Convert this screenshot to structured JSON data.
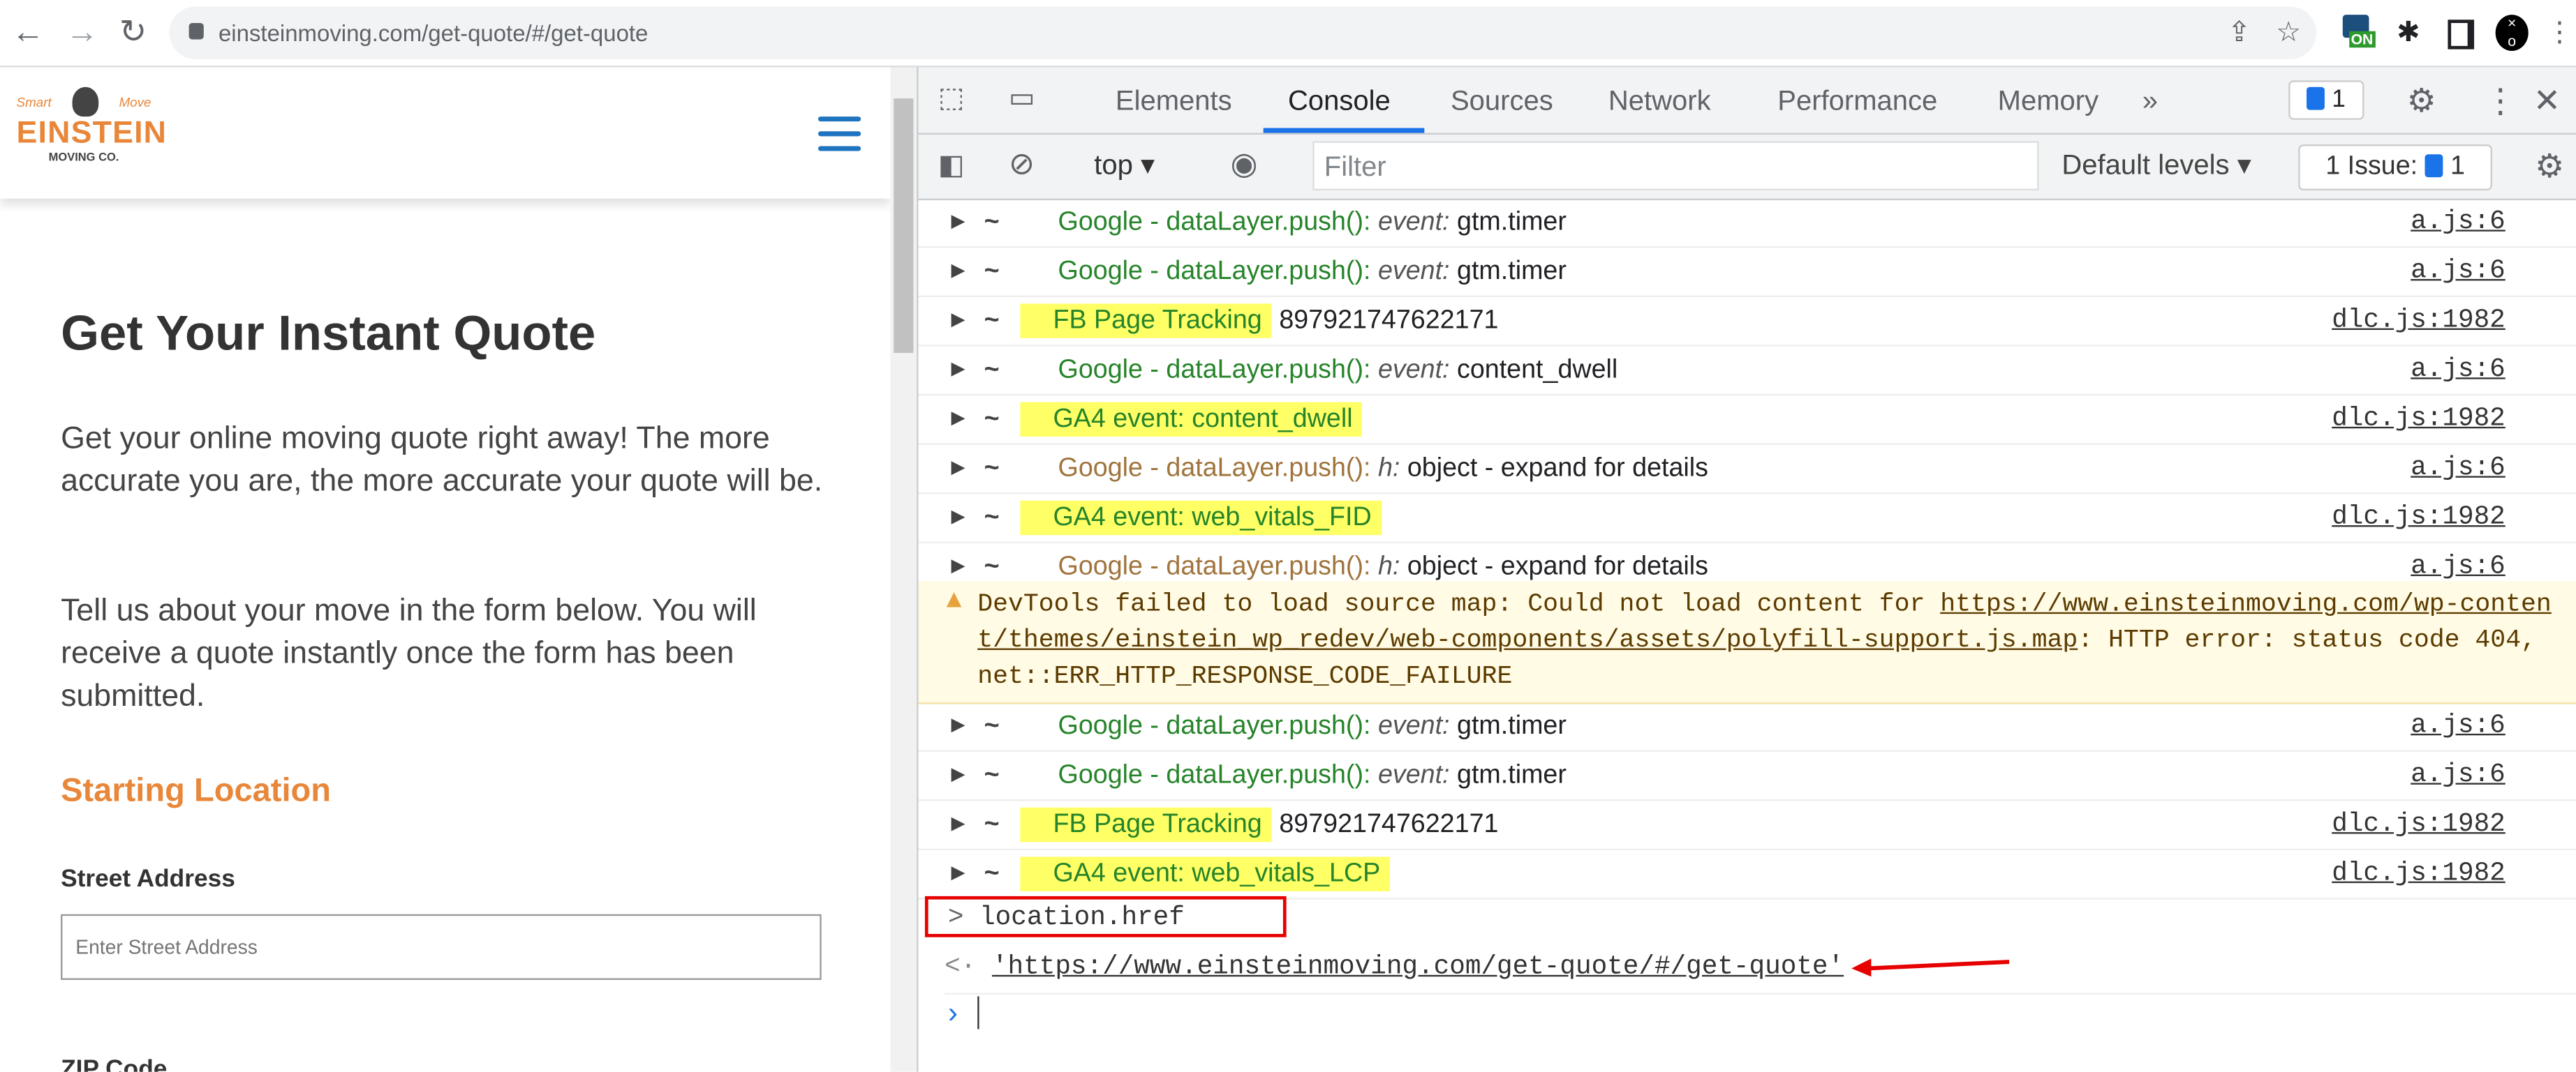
{
  "browser": {
    "url": "einsteinmoving.com/get-quote/#/get-quote",
    "extension_badge": "ON"
  },
  "site": {
    "logo": {
      "tagline_left": "Smart",
      "tagline_right": "Move",
      "name": "EINSTEIN",
      "sub": "MOVING CO."
    },
    "title": "Get Your Instant Quote",
    "paragraphs": [
      "Get your online moving quote right away! The more accurate you are, the more accurate your quote will be.",
      "Tell us about your move in the form below. You will receive a quote instantly once the form has been submitted."
    ],
    "section": "Starting Location",
    "street_label": "Street Address",
    "street_placeholder": "Enter Street Address",
    "zip_label": "ZIP Code",
    "colors": {
      "accent": "#e8873a",
      "menu": "#1f74bf"
    }
  },
  "devtools": {
    "tabs": [
      "Elements",
      "Console",
      "Sources",
      "Network",
      "Performance",
      "Memory"
    ],
    "active_tab": "Console",
    "messages_badge": "1",
    "context": "top",
    "filter_placeholder": "Filter",
    "levels": "Default levels",
    "issues_label": "1 Issue:",
    "issues_count": "1",
    "rows_a": [
      {
        "head": "Google - dataLayer.push():",
        "key": "event:",
        "val": "gtm.timer",
        "src": "a.js:6",
        "style": "g"
      },
      {
        "head": "Google - dataLayer.push():",
        "key": "event:",
        "val": "gtm.timer",
        "src": "a.js:6",
        "style": "g"
      },
      {
        "head": "FB Page Tracking",
        "val": "897921747622171",
        "src": "dlc.js:1982",
        "style": "hl"
      },
      {
        "head": "Google - dataLayer.push():",
        "key": "event:",
        "val": "content_dwell",
        "src": "a.js:6",
        "style": "g"
      },
      {
        "head": "GA4 event: content_dwell",
        "src": "dlc.js:1982",
        "style": "hl"
      },
      {
        "head": "Google - dataLayer.push():",
        "key": "h:",
        "val": "object - expand for details",
        "src": "a.js:6",
        "style": "b"
      },
      {
        "head": "GA4 event: web_vitals_FID",
        "src": "dlc.js:1982",
        "style": "hl"
      },
      {
        "head": "Google - dataLayer.push():",
        "key": "h:",
        "val": "object - expand for details",
        "src": "a.js:6",
        "style": "b"
      }
    ],
    "warning": {
      "prefix": "DevTools failed to load source map: Could not load content for ",
      "link": "https://www.einsteinmoving.com/wp-content/themes/einstein_wp_redev/web-components/assets/polyfill-support.js.map",
      "suffix": ": HTTP error: status code 404, net::ERR_HTTP_RESPONSE_CODE_FAILURE"
    },
    "rows_b": [
      {
        "head": "Google - dataLayer.push():",
        "key": "event:",
        "val": "gtm.timer",
        "src": "a.js:6",
        "style": "g"
      },
      {
        "head": "Google - dataLayer.push():",
        "key": "event:",
        "val": "gtm.timer",
        "src": "a.js:6",
        "style": "g"
      },
      {
        "head": "FB Page Tracking",
        "val": "897921747622171",
        "src": "dlc.js:1982",
        "style": "hl"
      },
      {
        "head": "GA4 event: web_vitals_LCP",
        "src": "dlc.js:1982",
        "style": "hl"
      }
    ],
    "command": "location.href",
    "result": "'https://www.einsteinmoving.com/get-quote/#/get-quote'",
    "annotation_color": "#e60000"
  }
}
